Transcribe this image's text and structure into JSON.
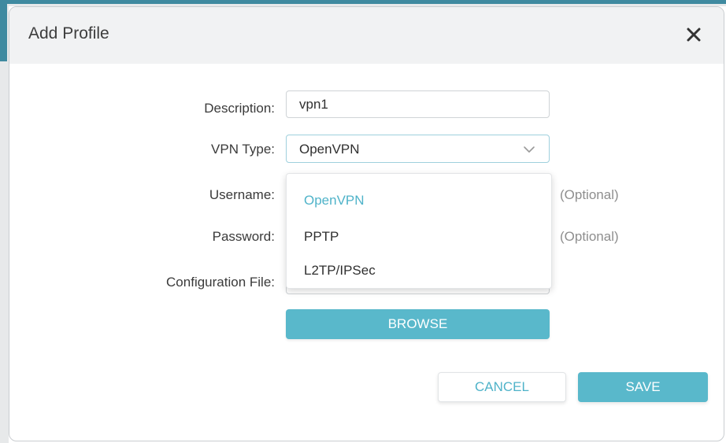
{
  "dialog": {
    "title": "Add Profile",
    "close_icon": "close-icon"
  },
  "form": {
    "description": {
      "label": "Description:",
      "value": "vpn1"
    },
    "vpn_type": {
      "label": "VPN Type:",
      "selected": "OpenVPN",
      "chevron_icon": "chevron-down-icon",
      "options": [
        "OpenVPN",
        "PPTP",
        "L2TP/IPSec"
      ]
    },
    "username": {
      "label": "Username:",
      "note": "(Optional)"
    },
    "password": {
      "label": "Password:",
      "note": "(Optional)"
    },
    "configuration_file": {
      "label": "Configuration File:"
    },
    "browse_label": "BROWSE"
  },
  "actions": {
    "cancel_label": "CANCEL",
    "save_label": "SAVE"
  },
  "colors": {
    "accent": "#59b8cb",
    "accent_text": "#4fb3c9",
    "header_bg": "#f1f2f3",
    "muted_text": "#8e8e8e"
  }
}
